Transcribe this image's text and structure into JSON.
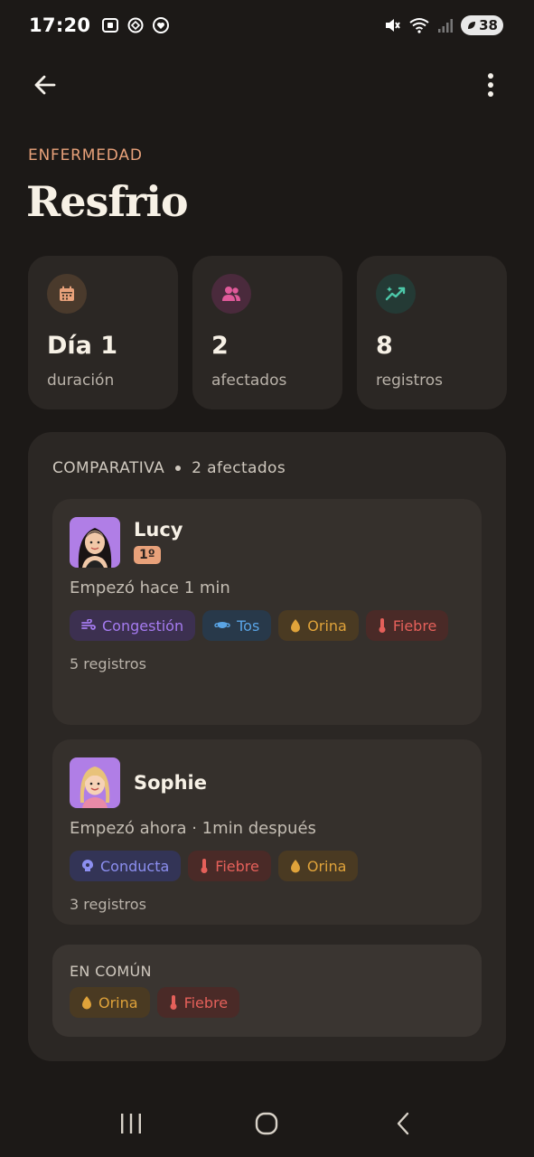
{
  "status_bar": {
    "time": "17:20",
    "battery": "38"
  },
  "header": {
    "eyebrow": "ENFERMEDAD",
    "title": "Resfrio"
  },
  "stats": [
    {
      "value": "Día 1",
      "label": "duración",
      "icon": "calendar-icon",
      "color": "#e8a17a"
    },
    {
      "value": "2",
      "label": "afectados",
      "icon": "users-icon",
      "color": "#e05a9a"
    },
    {
      "value": "8",
      "label": "registros",
      "icon": "trend-icon",
      "color": "#4cc7a8"
    }
  ],
  "comparison": {
    "heading": "COMPARATIVA",
    "count": "2 afectados",
    "people": [
      {
        "name": "Lucy",
        "rank": "1º",
        "started": "Empezó hace 1 min",
        "tags": [
          {
            "label": "Congestión",
            "icon": "congestion-icon"
          },
          {
            "label": "Tos",
            "icon": "mask-icon"
          },
          {
            "label": "Orina",
            "icon": "drop-icon"
          },
          {
            "label": "Fiebre",
            "icon": "thermometer-icon"
          }
        ],
        "records": "5 registros"
      },
      {
        "name": "Sophie",
        "started": "Empezó ahora · 1min después",
        "tags": [
          {
            "label": "Conducta",
            "icon": "brain-icon"
          },
          {
            "label": "Fiebre",
            "icon": "thermometer-icon"
          },
          {
            "label": "Orina",
            "icon": "drop-icon"
          }
        ],
        "records": "3 registros"
      }
    ],
    "common": {
      "title": "EN COMÚN",
      "tags": [
        {
          "label": "Orina",
          "icon": "drop-icon"
        },
        {
          "label": "Fiebre",
          "icon": "thermometer-icon"
        }
      ]
    }
  }
}
